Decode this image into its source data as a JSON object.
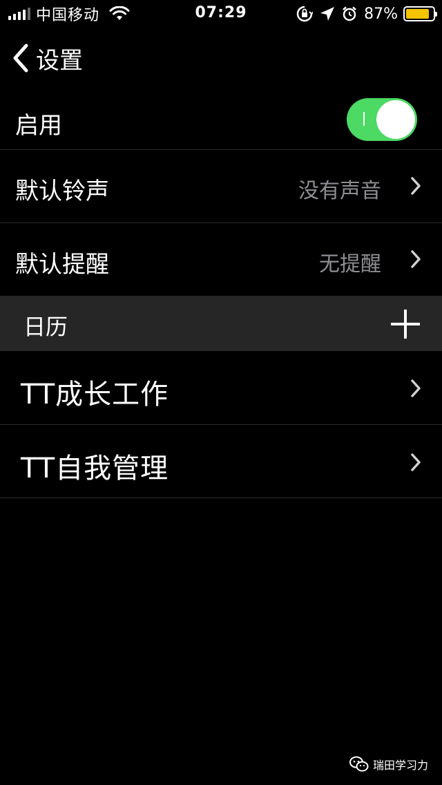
{
  "status_bar": {
    "carrier": "中国移动",
    "time": "07:29",
    "battery_percent": "87%",
    "battery_level": 0.87,
    "signal_bars_filled": 4,
    "signal_bars_total": 5,
    "icons": [
      "signal-icon",
      "wifi-icon",
      "orientation-lock-icon",
      "location-arrow-icon",
      "alarm-icon",
      "battery-icon"
    ]
  },
  "nav": {
    "back_label": "设置"
  },
  "settings": {
    "enable_label": "启用",
    "enable_on": true,
    "default_ringtone_label": "默认铃声",
    "default_ringtone_value": "没有声音",
    "default_reminder_label": "默认提醒",
    "default_reminder_value": "无提醒"
  },
  "calendars": {
    "header": "日历",
    "items": [
      {
        "label": "TT成长工作"
      },
      {
        "label": "TT自我管理"
      }
    ]
  },
  "watermark": {
    "text": "瑞田学习力"
  },
  "colors": {
    "background": "#000000",
    "toggle_on": "#4cd964",
    "battery": "#f5c400",
    "section_header": "#262626",
    "secondary_text": "#8e8e93"
  }
}
